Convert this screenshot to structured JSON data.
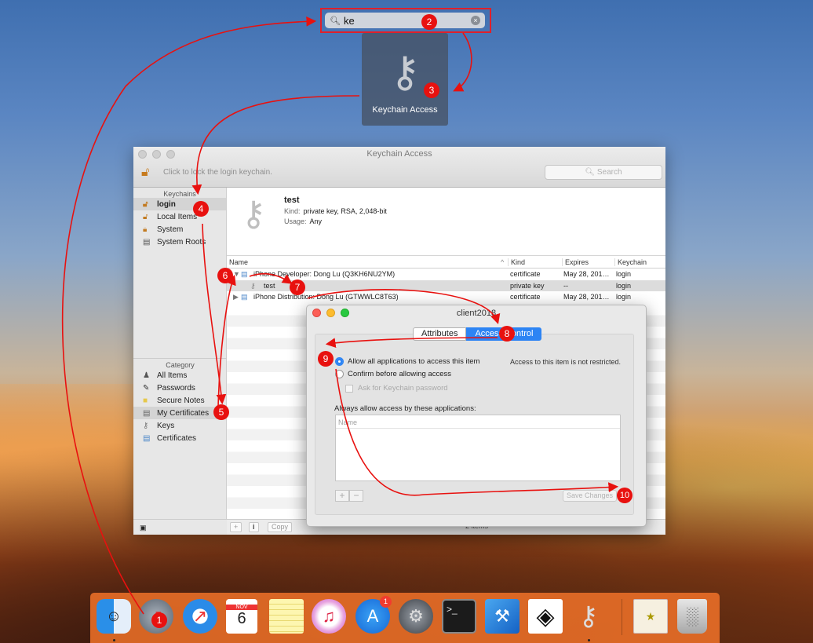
{
  "spotlight": {
    "query": "ke",
    "result_label": "Keychain Access"
  },
  "window": {
    "title": "Keychain Access",
    "lock_text": "Click to lock the login keychain.",
    "search_placeholder": "Search"
  },
  "sidebar": {
    "keychains_header": "Keychains",
    "keychains": [
      {
        "label": "login",
        "icon": "lock-open-icon"
      },
      {
        "label": "Local Items",
        "icon": "lock-open-icon"
      },
      {
        "label": "System",
        "icon": "lock-icon"
      },
      {
        "label": "System Roots",
        "icon": "folder-icon"
      }
    ],
    "category_header": "Category",
    "categories": [
      {
        "label": "All Items",
        "icon": "people-icon"
      },
      {
        "label": "Passwords",
        "icon": "pen-icon"
      },
      {
        "label": "Secure Notes",
        "icon": "note-icon"
      },
      {
        "label": "My Certificates",
        "icon": "certificate-icon"
      },
      {
        "label": "Keys",
        "icon": "key-icon"
      },
      {
        "label": "Certificates",
        "icon": "certificate-icon"
      }
    ]
  },
  "detail": {
    "name": "test",
    "kind_label": "Kind:",
    "kind": "private key, RSA, 2,048-bit",
    "usage_label": "Usage:",
    "usage": "Any"
  },
  "table": {
    "columns": {
      "name": "Name",
      "kind": "Kind",
      "expires": "Expires",
      "keychain": "Keychain"
    },
    "rows": [
      {
        "name": "iPhone Developer: Dong Lu (Q3KH6NU2YM)",
        "kind": "certificate",
        "expires": "May 28, 201…",
        "keychain": "login"
      },
      {
        "name": "test",
        "kind": "private key",
        "expires": "--",
        "keychain": "login"
      },
      {
        "name": "iPhone Distribution: Dong Lu (GTWWLC8T63)",
        "kind": "certificate",
        "expires": "May 28, 201…",
        "keychain": "login"
      }
    ],
    "item_count": "2 items",
    "copy_label": "Copy",
    "info_label": "i",
    "add_label": "+"
  },
  "dialog": {
    "title": "client2018",
    "tab_attributes": "Attributes",
    "tab_access": "Access Control",
    "radio_allow": "Allow all applications to access this item",
    "radio_confirm": "Confirm before allowing access",
    "check_ask": "Ask for Keychain password",
    "note": "Access to this item is not restricted.",
    "always_allow": "Always allow access by these applications:",
    "list_header": "Name",
    "plus": "+",
    "minus": "−",
    "save_label": "Save Changes"
  },
  "dock": {
    "calendar_month": "NOV",
    "calendar_day": "6",
    "appstore_badge": "1"
  },
  "steps": [
    "1",
    "2",
    "3",
    "4",
    "5",
    "6",
    "7",
    "8",
    "9",
    "10"
  ],
  "colors": {
    "annotation": "#e8110f",
    "accent": "#2d84f4",
    "dock": "#ec7028"
  }
}
